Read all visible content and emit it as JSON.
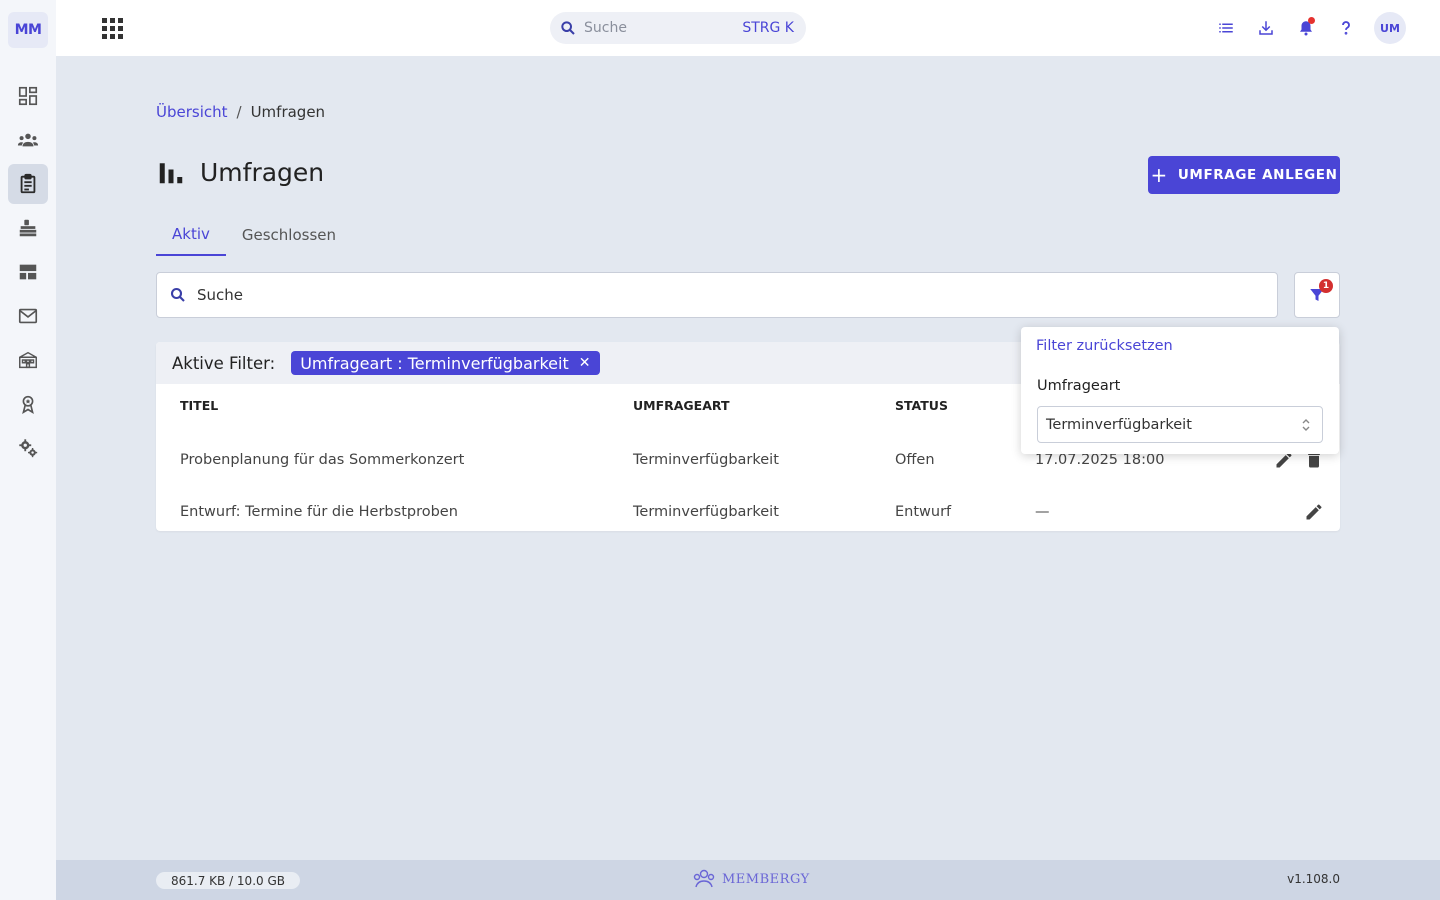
{
  "app": {
    "logo_text": "MM",
    "accent_color": "#4a45d6"
  },
  "sidebar": {
    "items": [
      {
        "name": "dashboard",
        "icon": "dashboard-icon"
      },
      {
        "name": "members",
        "icon": "people-group-icon"
      },
      {
        "name": "surveys",
        "icon": "clipboard-icon",
        "active": true
      },
      {
        "name": "events",
        "icon": "stage-icon"
      },
      {
        "name": "pages",
        "icon": "layout-icon"
      },
      {
        "name": "mail",
        "icon": "mail-icon"
      },
      {
        "name": "organisation",
        "icon": "building-icon"
      },
      {
        "name": "awards",
        "icon": "award-icon"
      },
      {
        "name": "settings",
        "icon": "gears-icon"
      }
    ]
  },
  "topbar": {
    "search_placeholder": "Suche",
    "search_shortcut": "STRG K",
    "avatar_initials": "UM"
  },
  "breadcrumb": {
    "home": "Übersicht",
    "separator": "/",
    "current": "Umfragen"
  },
  "page": {
    "title": "Umfragen",
    "create_button": "UMFRAGE ANLEGEN"
  },
  "tabs": [
    {
      "label": "Aktiv",
      "active": true
    },
    {
      "label": "Geschlossen",
      "active": false
    }
  ],
  "search": {
    "value": "Suche"
  },
  "filter_button": {
    "badge_count": "1"
  },
  "active_filters": {
    "label": "Aktive Filter:",
    "chip": "Umfrageart : Terminverfügbarkeit"
  },
  "table": {
    "columns": [
      "TITEL",
      "UMFRAGEART",
      "STATUS"
    ],
    "rows": [
      {
        "title": "Probenplanung für das Sommerkonzert",
        "type": "Terminverfügbarkeit",
        "status": "Offen",
        "date": "17.07.2025 18:00"
      },
      {
        "title": "Entwurf: Termine für die Herbstproben",
        "type": "Terminverfügbarkeit",
        "status": "Entwurf",
        "date": "—"
      }
    ]
  },
  "filter_popup": {
    "reset": "Filter zurücksetzen",
    "field_label": "Umfrageart",
    "selected": "Terminverfügbarkeit"
  },
  "footer": {
    "storage": "861.7 KB / 10.0 GB",
    "brand": "MEMBERGY",
    "version": "v1.108.0"
  }
}
